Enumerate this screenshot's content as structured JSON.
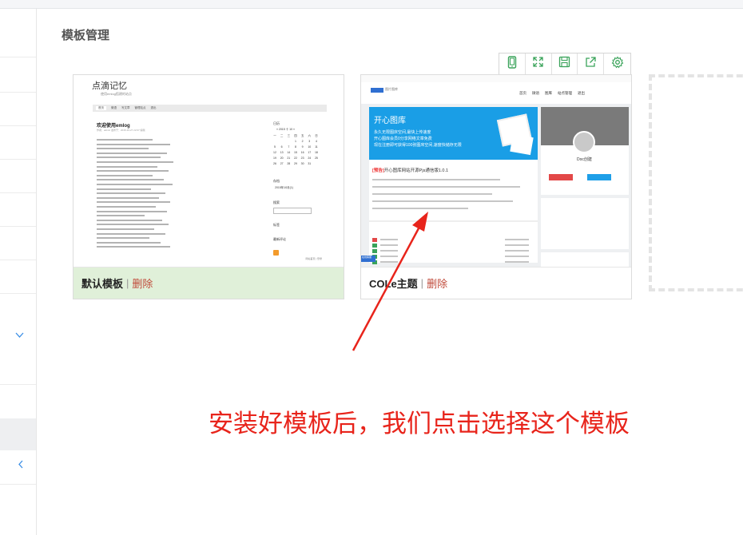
{
  "page": {
    "title": "模板管理"
  },
  "toolbar": {
    "buttons": [
      {
        "icon": "mobile-icon",
        "label": "mobile"
      },
      {
        "icon": "fullscreen-icon",
        "label": "fullscreen"
      },
      {
        "icon": "save-icon",
        "label": "save"
      },
      {
        "icon": "share-icon",
        "label": "share"
      },
      {
        "icon": "gear-icon",
        "label": "settings"
      }
    ]
  },
  "templates": [
    {
      "name": "默认模板",
      "separator": "|",
      "delete_label": "删除",
      "selected": true,
      "preview": {
        "logo": "点滴记忆",
        "subtitle": "使用emlog搭建的站点",
        "nav": [
          "首页",
          "微语",
          "写文章",
          "管理站点",
          "退出"
        ],
        "post_title": "欢迎使用emlog",
        "post_meta": "作者：admin 发布于：2015-10-27 22:07 编辑",
        "side_calendar_label": "日历",
        "calendar_title": "« 2015 十 10 »",
        "calendar_rows": [
          [
            "一",
            "二",
            "三",
            "四",
            "五",
            "六",
            "日"
          ],
          [
            "",
            "",
            "1",
            "2",
            "3",
            "4"
          ],
          [
            "5",
            "6",
            "7",
            "8",
            "9",
            "10",
            "11"
          ],
          [
            "12",
            "13",
            "14",
            "15",
            "16",
            "17",
            "18"
          ],
          [
            "19",
            "20",
            "21",
            "22",
            "23",
            "24",
            "25"
          ],
          [
            "26",
            "27",
            "28",
            "29",
            "30",
            "31",
            ""
          ]
        ],
        "side_archive_label": "存档",
        "side_archive_item": "2015年10月(1)",
        "side_search_label": "搜索",
        "side_tag_label": "标签",
        "side_comment_label": "最新评论",
        "footer": "网站首页 | 登录"
      }
    },
    {
      "name": "COLe主题",
      "separator": "|",
      "delete_label": "删除",
      "selected": false,
      "preview": {
        "logo_text": "图片图库",
        "nav": [
          "首页",
          "微语",
          "图库",
          "站点管理",
          "退出"
        ],
        "banner_title": "开心图库",
        "banner_lines": [
          "永久无限图床空间,最快上传速度",
          "开心图库会员0分享网络文章免费",
          "现在注册即可获得100张图床空间,速度快储存无限"
        ],
        "article_title_prefix": "[预告]",
        "article_title": "开心图库网站开源Pjs通信版1.0.1",
        "sidebar_name": "Doc创建",
        "online_label": "在线客服"
      }
    }
  ],
  "annotation": {
    "text": "安装好模板后，我们点击选择这个模板",
    "color": "#e8241b"
  },
  "colors": {
    "selected_footer": "#e0f0d9",
    "delete_link": "#c04a3a",
    "accent": "#3a8ee6"
  }
}
